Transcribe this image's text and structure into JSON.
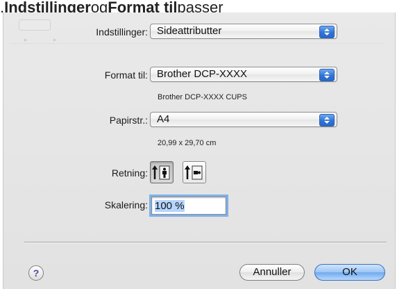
{
  "top_fragment": {
    "before": ", ",
    "bold1": "Indstillinger",
    "middle": " og ",
    "bold2": "Format til",
    "after": " passer"
  },
  "dialog": {
    "settings": {
      "label": "Indstillinger:",
      "value": "Sideattributter"
    },
    "format_for": {
      "label": "Format til:",
      "value": "Brother DCP-XXXX",
      "sub": "Brother DCP-XXXX CUPS"
    },
    "paper_size": {
      "label": "Papirstr.:",
      "value": "A4",
      "sub": "20,99 x 29,70 cm"
    },
    "orientation": {
      "label": "Retning:",
      "options": [
        "portrait",
        "landscape"
      ],
      "selected": "portrait"
    },
    "scale": {
      "label": "Skalering:",
      "value": "100 %"
    },
    "buttons": {
      "help": "?",
      "cancel": "Annuller",
      "ok": "OK"
    },
    "colors": {
      "accent": "#2f74d6",
      "focus_ring": "#7fb0ea",
      "help_glyph": "#5d3fa0"
    }
  }
}
